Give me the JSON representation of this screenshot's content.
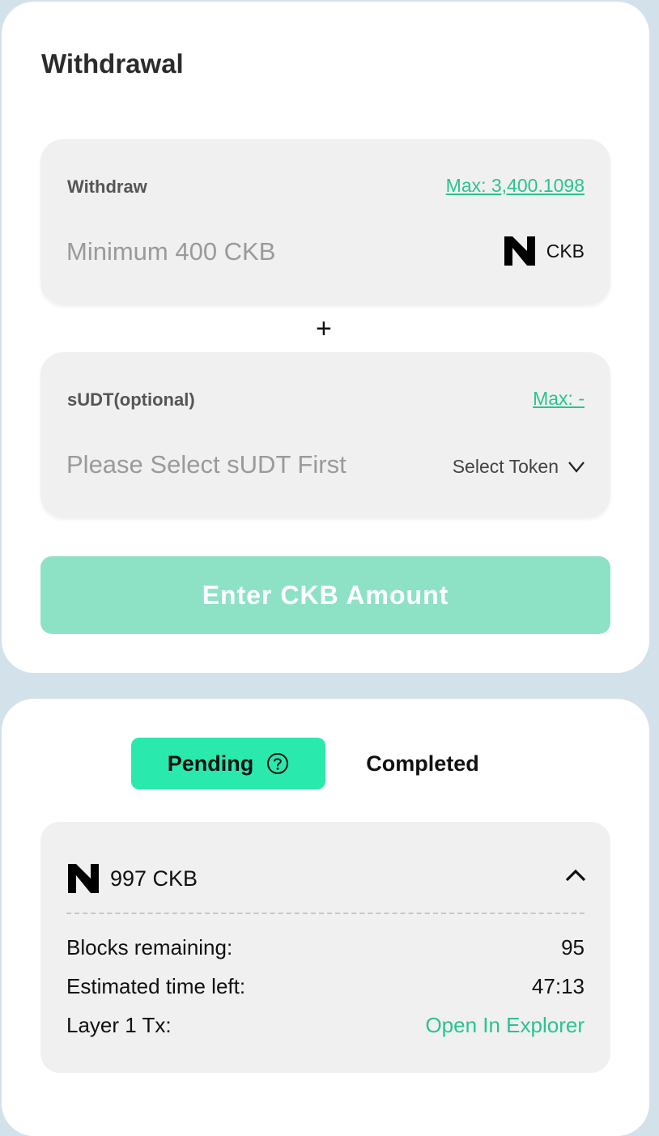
{
  "withdrawal": {
    "title": "Withdrawal",
    "ckb_box": {
      "label": "Withdraw",
      "max_text": "Max: 3,400.1098",
      "placeholder": "Minimum 400 CKB",
      "token": "CKB",
      "token_icon": "nervos-logo-icon"
    },
    "plus": "+",
    "sudt_box": {
      "label": "sUDT(optional)",
      "max_text": "Max: -",
      "placeholder": "Please Select sUDT First",
      "select_label": "Select Token"
    },
    "submit_label": "Enter CKB Amount"
  },
  "history": {
    "tabs": {
      "pending": "Pending",
      "completed": "Completed"
    },
    "item": {
      "amount": "997 CKB",
      "rows": [
        {
          "label": "Blocks remaining:",
          "value": "95"
        },
        {
          "label": "Estimated time left:",
          "value": "47:13"
        },
        {
          "label": "Layer 1 Tx:",
          "value": "Open In Explorer"
        }
      ]
    }
  },
  "colors": {
    "accent": "#2ac48e",
    "tab_active": "#2ae9ad",
    "button_disabled": "#8de2c6",
    "background": "#d3e2ea"
  }
}
